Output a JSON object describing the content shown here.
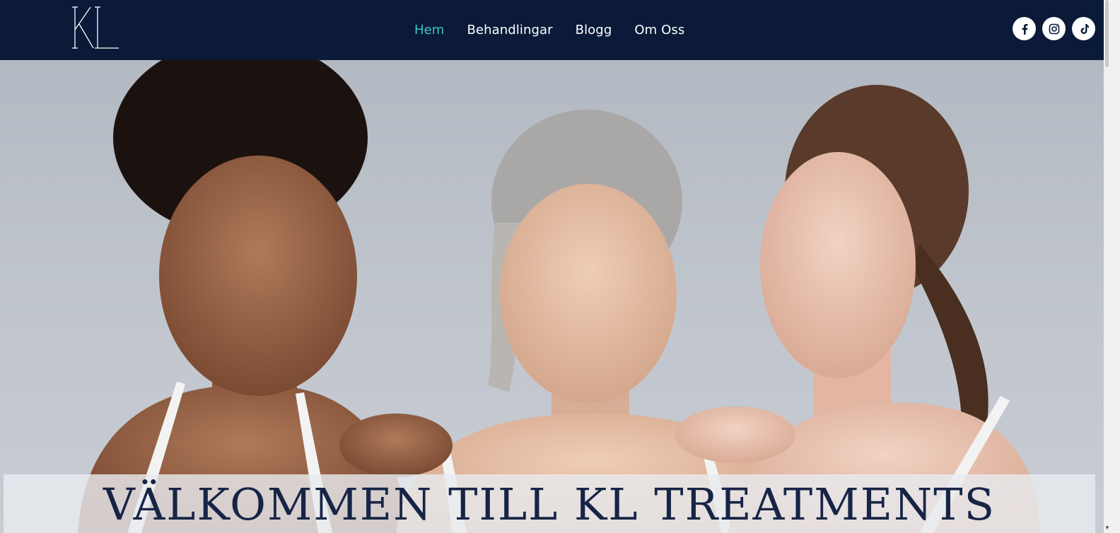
{
  "brand": {
    "logo_text": "KL"
  },
  "nav": {
    "items": [
      {
        "label": "Hem",
        "active": true
      },
      {
        "label": "Behandlingar",
        "active": false
      },
      {
        "label": "Blogg",
        "active": false
      },
      {
        "label": "Om Oss",
        "active": false
      }
    ]
  },
  "social": {
    "icons": [
      "facebook-icon",
      "instagram-icon",
      "tiktok-icon"
    ]
  },
  "hero": {
    "heading": "VÄLKOMMEN TILL KL TREATMENTS"
  },
  "colors": {
    "header_bg": "#0a1a38",
    "nav_active": "#3fc6c6",
    "nav_text": "#ffffff",
    "heading": "#172446"
  }
}
